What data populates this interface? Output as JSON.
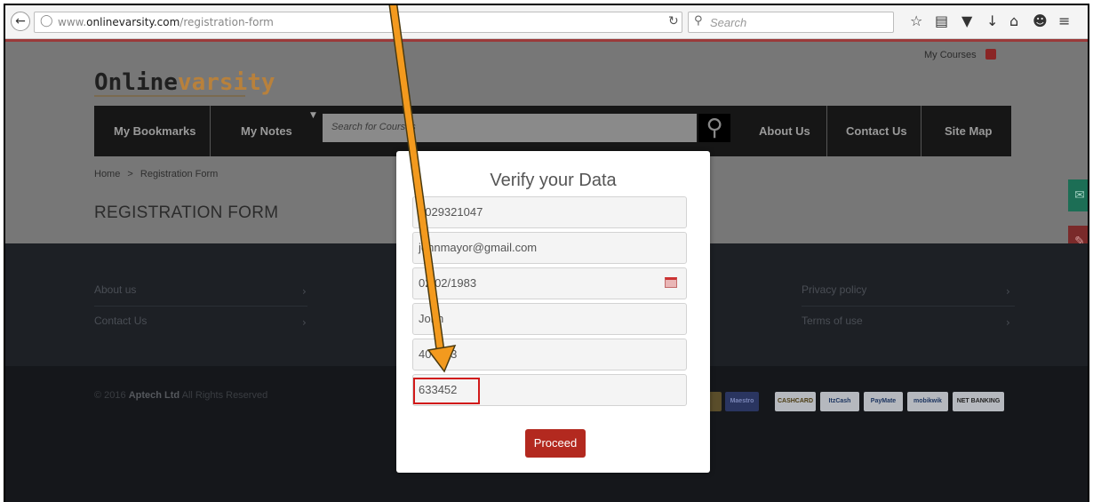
{
  "browser": {
    "url_prefix": "www.",
    "url_domain": "onlinevarsity.com",
    "url_path": "/registration-form",
    "search_placeholder": "Search",
    "icons": [
      "back-icon",
      "site-info-icon",
      "reload-icon",
      "search-icon",
      "bookmark-star-icon",
      "reading-list-icon",
      "pocket-icon",
      "download-icon",
      "home-icon",
      "smiley-icon",
      "menu-icon"
    ]
  },
  "site": {
    "logo_part1": "Online",
    "logo_part2": "varsity",
    "my_courses": "My Courses",
    "nav": {
      "bookmarks": "My Bookmarks",
      "notes": "My Notes",
      "search_placeholder": "Search for Courses",
      "about": "About Us",
      "contact": "Contact Us",
      "sitemap": "Site Map"
    },
    "breadcrumb": {
      "home": "Home",
      "separator": ">",
      "current": "Registration Form"
    },
    "page_title": "REGISTRATION FORM",
    "footer": {
      "links_left": [
        "About us",
        "Contact Us"
      ],
      "links_right": [
        "Privacy policy",
        "Terms of use"
      ],
      "copyright_prefix": "© 2016 ",
      "copyright_company": "Aptech Ltd",
      "copyright_suffix": " All Rights Reserved",
      "payment_methods": [
        "Maestro",
        "CASHCARD",
        "ItzCash",
        "PayMate",
        "mobikwik",
        "NET BANKING"
      ]
    }
  },
  "modal": {
    "title": "Verify your Data",
    "fields": [
      "9029321047",
      "johnmayor@gmail.com",
      "02/02/1983",
      "John",
      "400093",
      "633452"
    ],
    "proceed_label": "Proceed"
  },
  "colors": {
    "accent_red": "#b3291f",
    "annotation_orange": "#f39a1e",
    "highlight_red": "#d11a1a"
  }
}
